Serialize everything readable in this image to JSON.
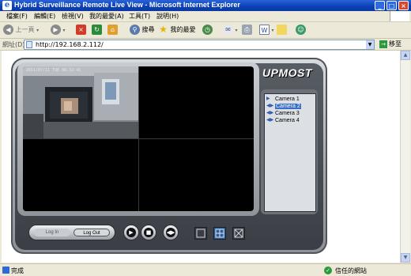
{
  "window": {
    "title": "Hybrid Surveillance Remote Live View - Microsoft Internet Explorer",
    "controls": [
      "_",
      "□",
      "×"
    ]
  },
  "menu": [
    "檔案(F)",
    "編輯(E)",
    "檢視(V)",
    "我的最愛(A)",
    "工具(T)",
    "說明(H)"
  ],
  "toolbar": {
    "back_label": "上一頁",
    "search_label": "搜尋",
    "favorites_label": "我的最愛"
  },
  "address": {
    "label": "網址(D)",
    "url": "http://192.168.2.112/",
    "go_label": "移至"
  },
  "app": {
    "logo": "UPMOST",
    "osd": "2011/07/11 TUE 08:32:41",
    "cameras": [
      "Camera 1",
      "Camera 2",
      "Camera 3",
      "Camera 4"
    ],
    "selected_camera_index": 1,
    "login_label": "Log In",
    "logout_label": "Log Out"
  },
  "status": {
    "text": "完成",
    "zone": "信任的網站"
  }
}
